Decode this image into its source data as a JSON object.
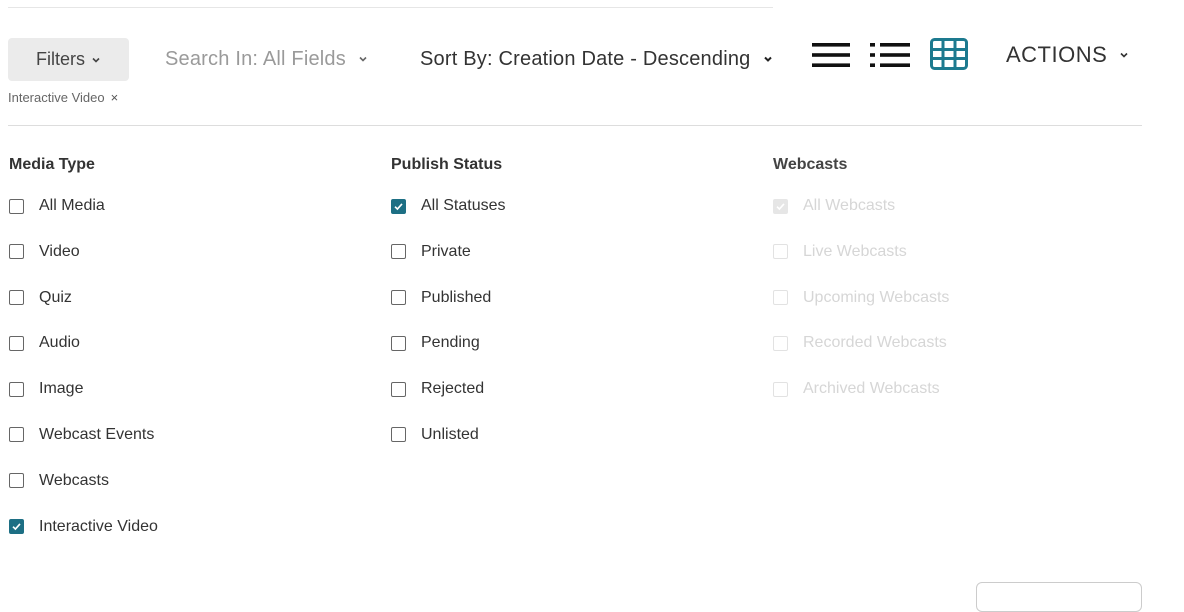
{
  "toolbar": {
    "filters_label": "Filters",
    "search_in_label": "Search In: All Fields",
    "sort_by_label": "Sort By: Creation Date - Descending",
    "actions_label": "ACTIONS",
    "view_icons": [
      "table-view-icon",
      "list-view-icon",
      "grid-view-icon"
    ],
    "active_view": "grid-view-icon"
  },
  "active_filter_chip": {
    "label": "Interactive Video",
    "remove_glyph": "×"
  },
  "filter_columns": {
    "media_type": {
      "title": "Media Type",
      "options": [
        {
          "label": "All Media",
          "checked": false
        },
        {
          "label": "Video",
          "checked": false
        },
        {
          "label": "Quiz",
          "checked": false
        },
        {
          "label": "Audio",
          "checked": false
        },
        {
          "label": "Image",
          "checked": false
        },
        {
          "label": "Webcast Events",
          "checked": false
        },
        {
          "label": "Webcasts",
          "checked": false
        },
        {
          "label": "Interactive Video",
          "checked": true
        }
      ]
    },
    "publish_status": {
      "title": "Publish Status",
      "options": [
        {
          "label": "All Statuses",
          "checked": true
        },
        {
          "label": "Private",
          "checked": false
        },
        {
          "label": "Published",
          "checked": false
        },
        {
          "label": "Pending",
          "checked": false
        },
        {
          "label": "Rejected",
          "checked": false
        },
        {
          "label": "Unlisted",
          "checked": false
        }
      ]
    },
    "webcasts": {
      "title": "Webcasts",
      "disabled": true,
      "options": [
        {
          "label": "All Webcasts",
          "checked": true
        },
        {
          "label": "Live Webcasts",
          "checked": false
        },
        {
          "label": "Upcoming Webcasts",
          "checked": false
        },
        {
          "label": "Recorded Webcasts",
          "checked": false
        },
        {
          "label": "Archived Webcasts",
          "checked": false
        }
      ]
    }
  },
  "colors": {
    "accent": "#1d6f84",
    "text": "#333333",
    "muted": "#9a9a9a",
    "disabled": "#d6d6d6",
    "button_bg": "#ebebeb"
  }
}
